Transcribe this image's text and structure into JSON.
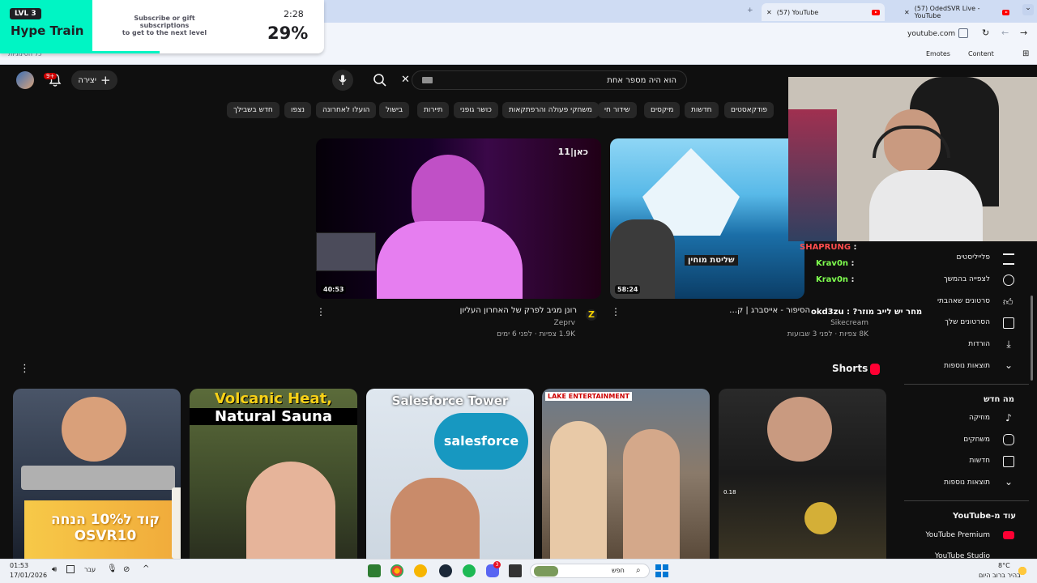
{
  "browser": {
    "tabs": [
      {
        "label": "(57) YouTube",
        "active": true
      },
      {
        "label": "(57) OdedSVR Live - YouTube",
        "active": false
      }
    ],
    "address": "youtube.com",
    "bookmarks": {
      "emotes": "Emotes",
      "content": "Content",
      "left_folder": "כל הסימניות"
    }
  },
  "hype_train": {
    "level": "LVL 3",
    "title": "Hype Train",
    "desc_line1": "Subscribe or gift subscriptions",
    "desc_line2": "to get to the next level",
    "time": "2:28",
    "percent": "29%",
    "progress": 0.29,
    "accent": "#00f5c4"
  },
  "yt_header": {
    "create_label": "יצירה",
    "notif_count": "9+",
    "search_query": "הוא היה מספר אחת",
    "icons": [
      "mic-icon",
      "search-icon",
      "close-icon",
      "keyboard-icon",
      "bell-icon",
      "plus-icon"
    ]
  },
  "chips": [
    "חדש בשבילך",
    "נצפו",
    "הועלו לאחרונה",
    "בישול",
    "תיירות",
    "כושר גופני",
    "משחקי פעולה והרפתקאות",
    "שידור חי",
    "מיקסים",
    "חדשות",
    "פודקאסטים"
  ],
  "videos": [
    {
      "title": "רונן מגיב לפרק של האחרון העליון",
      "channel": "Zeprv",
      "meta": "1.9K צפיות · לפני 6 ימים",
      "duration": "40:53",
      "badge": "כאן|11"
    },
    {
      "title": "הסיפור - אייסברג | ק…",
      "channel": "Sikecream",
      "meta": "8K צפיות · לפני 3 שבועות",
      "duration": "58:24",
      "overlay_text": "שליטת מוחין"
    }
  ],
  "shorts": {
    "heading": "Shorts",
    "items": [
      {
        "overlay": "קוד ל10% הנחה OSVR10"
      },
      {
        "overlay_line1": "Volcanic Heat,",
        "overlay_line2": "Natural Sauna"
      },
      {
        "overlay_line1": "Salesforce Tower",
        "overlay_line2": "salesforce"
      },
      {
        "overlay": "LAKE ENTERTAINMENT"
      },
      {
        "overlay": "0.18"
      }
    ]
  },
  "sidebar": {
    "you_items": [
      "פלייליסטים",
      "לצפייה בהמשך",
      "סרטונים שאהבתי",
      "הסרטונים שלך",
      "הורדות",
      "תוצאות נוספות"
    ],
    "explore_heading": "מה חדש",
    "explore_items": [
      "מוזיקה",
      "משחקים",
      "חדשות",
      "תוצאות נוספות"
    ],
    "more_heading": "עוד מ-YouTube",
    "more_items": [
      "YouTube Premium",
      "YouTube Studio"
    ]
  },
  "chat_overlay": {
    "lines": [
      {
        "user": "SHAPRUNG",
        "sep": " :",
        "color": "#ff4d4d"
      },
      {
        "user": "Krav0n",
        "sep": " :",
        "color": "#7fff4f"
      },
      {
        "user": "Krav0n",
        "sep": " :",
        "color": "#7fff4f"
      },
      {
        "user": "מחר יש לייב מוזר? : okd3zu",
        "sep": "",
        "color": "#ffffff"
      }
    ]
  },
  "taskbar": {
    "time": "01:53",
    "date": "17/01/2026",
    "lang": "עבר",
    "search": "חפש",
    "weather_temp": "8°C",
    "weather_desc": "בהיר ברוב היום",
    "chat_badge": "3"
  }
}
